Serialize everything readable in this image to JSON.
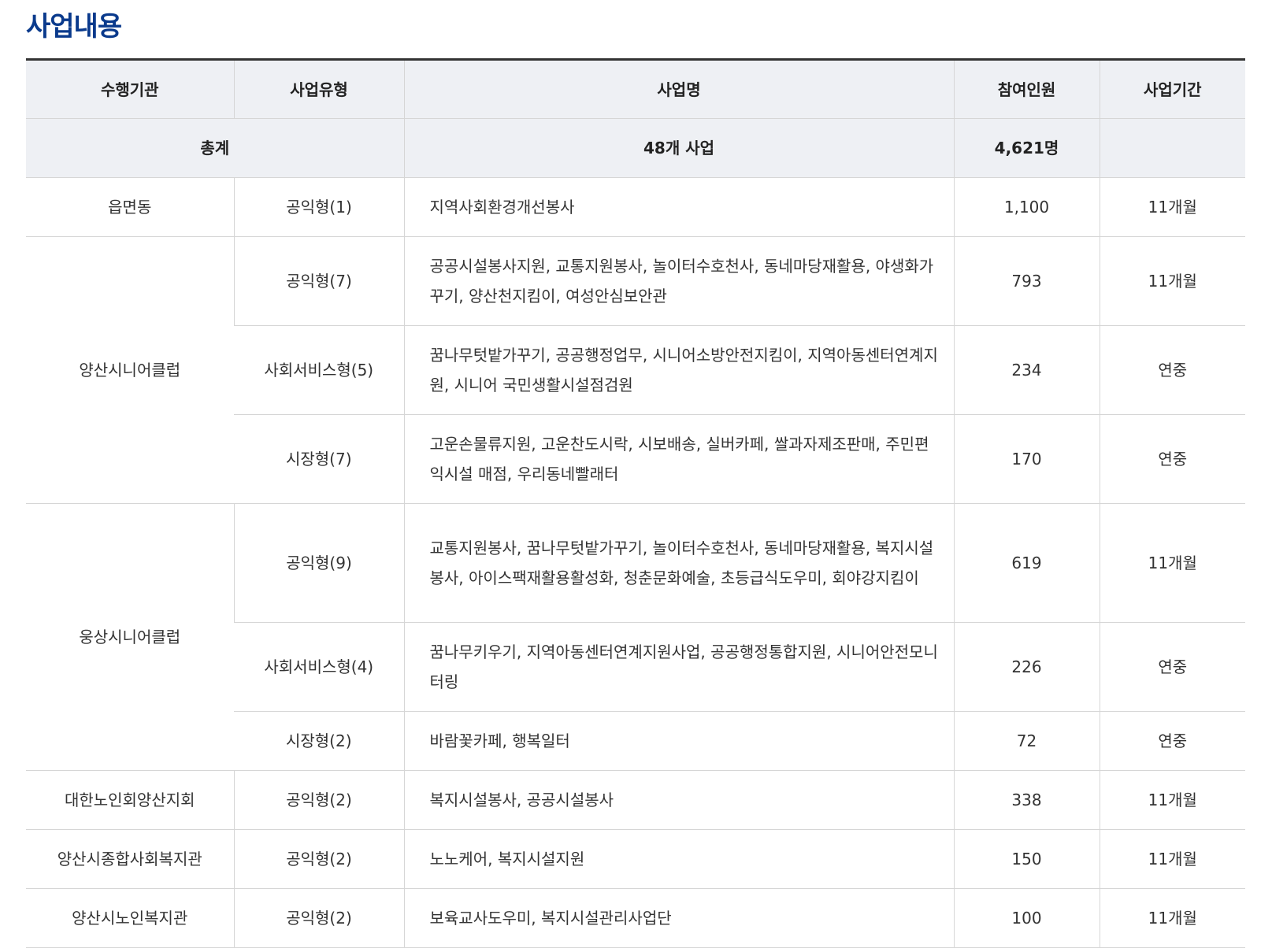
{
  "page_title": "사업내용",
  "headers": [
    "수행기관",
    "사업유형",
    "사업명",
    "참여인원",
    "사업기간"
  ],
  "total": {
    "label": "총계",
    "business_count": "48개 사업",
    "participants": "4,621명",
    "period": ""
  },
  "rows": [
    {
      "agency": "읍면동",
      "type": "공익형(1)",
      "name": "지역사회환경개선봉사",
      "people": "1,100",
      "period": "11개월"
    },
    {
      "agency": "양산시니어클럽",
      "type": "공익형(7)",
      "name": "공공시설봉사지원, 교통지원봉사, 놀이터수호천사, 동네마당재활용, 야생화가꾸기, 양산천지킴이, 여성안심보안관",
      "people": "793",
      "period": "11개월"
    },
    {
      "agency": "",
      "type": "사회서비스형(5)",
      "name": "꿈나무텃밭가꾸기, 공공행정업무, 시니어소방안전지킴이, 지역아동센터연계지원, 시니어 국민생활시설점검원",
      "people": "234",
      "period": "연중"
    },
    {
      "agency": "",
      "type": "시장형(7)",
      "name": "고운손물류지원, 고운찬도시락, 시보배송, 실버카페, 쌀과자제조판매, 주민편익시설 매점, 우리동네빨래터",
      "people": "170",
      "period": "연중"
    },
    {
      "agency": "웅상시니어클럽",
      "type": "공익형(9)",
      "name": "교통지원봉사, 꿈나무텃밭가꾸기, 놀이터수호천사, 동네마당재활용, 복지시설봉사, 아이스팩재활용활성화, 청춘문화예술, 초등급식도우미, 회야강지킴이",
      "people": "619",
      "period": "11개월"
    },
    {
      "agency": "",
      "type": "사회서비스형(4)",
      "name": "꿈나무키우기, 지역아동센터연계지원사업, 공공행정통합지원, 시니어안전모니터링",
      "people": "226",
      "period": "연중"
    },
    {
      "agency": "",
      "type": "시장형(2)",
      "name": "바람꽃카페, 행복일터",
      "people": "72",
      "period": "연중"
    },
    {
      "agency": "대한노인회양산지회",
      "type": "공익형(2)",
      "name": "복지시설봉사, 공공시설봉사",
      "people": "338",
      "period": "11개월"
    },
    {
      "agency": "양산시종합사회복지관",
      "type": "공익형(2)",
      "name": "노노케어, 복지시설지원",
      "people": "150",
      "period": "11개월"
    },
    {
      "agency": "양산시노인복지관",
      "type": "공익형(2)",
      "name": "보육교사도우미, 복지시설관리사업단",
      "people": "100",
      "period": "11개월"
    }
  ]
}
